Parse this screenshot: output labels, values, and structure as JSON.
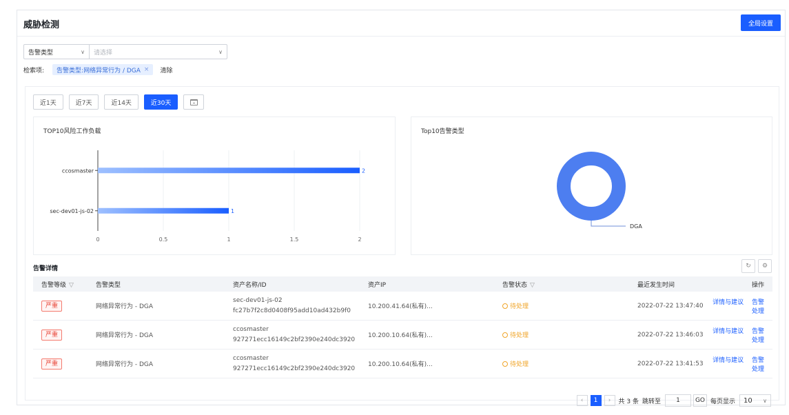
{
  "header": {
    "title": "威胁检测",
    "global_settings": "全局设置"
  },
  "filter": {
    "type_select": "告警类型",
    "value_placeholder": "请选择"
  },
  "search": {
    "label": "检索项:",
    "tag": "告警类型:网络异常行为 / DGA",
    "tag_close": "×",
    "clear": "清除"
  },
  "ranges": {
    "items": [
      "近1天",
      "近7天",
      "近14天",
      "近30天"
    ],
    "active": "近30天"
  },
  "colors": {
    "accent": "#1a5eff",
    "bar": "#1a5eff",
    "donut": "#4d7ef0",
    "danger": "#e84a3c",
    "warning": "#f0a52a"
  },
  "chart_data": [
    {
      "type": "bar",
      "orientation": "horizontal",
      "title": "TOP10风险工作负载",
      "categories": [
        "ccosmaster",
        "sec-dev01-js-02"
      ],
      "values": [
        2,
        1
      ],
      "xlim": [
        0,
        2
      ],
      "xticks": [
        "0",
        "0.5",
        "1",
        "1.5",
        "2"
      ],
      "grid": true
    },
    {
      "type": "pie",
      "style": "donut",
      "title": "Top10告警类型",
      "labels": [
        "DGA"
      ],
      "values": [
        1
      ]
    }
  ],
  "details": {
    "title": "告警详情",
    "columns": [
      "告警等级",
      "告警类型",
      "资产名称/ID",
      "资产IP",
      "告警状态",
      "最近发生时间",
      "操作"
    ],
    "rows": [
      {
        "severity": "严重",
        "type": "网络异常行为 - DGA",
        "asset_name": "sec-dev01-js-02",
        "asset_id": "fc27b7f2c8d0408f95add10ad432b9f0",
        "ip": "10.200.41.64(私有)...",
        "status": "待处理",
        "time": "2022-07-22 13:47:40",
        "action1": "详情与建议",
        "action2": "告警处理"
      },
      {
        "severity": "严重",
        "type": "网络异常行为 - DGA",
        "asset_name": "ccosmaster",
        "asset_id": "927271ecc16149c2bf2390e240dc3920",
        "ip": "10.200.10.64(私有)...",
        "status": "待处理",
        "time": "2022-07-22 13:46:03",
        "action1": "详情与建议",
        "action2": "告警处理"
      },
      {
        "severity": "严重",
        "type": "网络异常行为 - DGA",
        "asset_name": "ccosmaster",
        "asset_id": "927271ecc16149c2bf2390e240dc3920",
        "ip": "10.200.10.64(私有)...",
        "status": "待处理",
        "time": "2022-07-22 13:41:53",
        "action1": "详情与建议",
        "action2": "告警处理"
      }
    ]
  },
  "pagination": {
    "current_page": "1",
    "total": "共 3 条",
    "jump_label": "跳转至",
    "jump_value": "1",
    "go": "GO",
    "page_size_label": "每页显示",
    "page_size": "10"
  }
}
